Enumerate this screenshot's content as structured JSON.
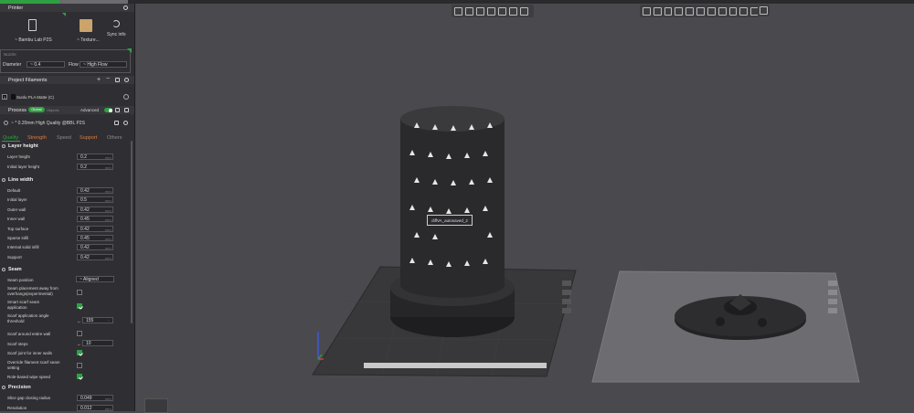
{
  "printer": {
    "section_title": "Printer",
    "printer_name": "Bambu Lab P2S",
    "plate_label": "Texture...",
    "sync_label": "Sync info"
  },
  "nozzle": {
    "label": "Nozzle",
    "diameter_label": "Diameter",
    "diameter_value": "0.4",
    "flow_label": "Flow",
    "flow_value": "High Flow"
  },
  "filaments": {
    "section_title": "Project Filaments",
    "items": [
      {
        "index": "1",
        "name": "Sunlu PLA Matte (C)"
      }
    ]
  },
  "process": {
    "section_title": "Process",
    "toggle_global": "Global",
    "toggle_objects": "Objects",
    "advanced_label": "Advanced",
    "profile_name": "* 0.20mm High Quality @BBL P2S",
    "tabs": [
      "Quality",
      "Strength",
      "Speed",
      "Support",
      "Others"
    ]
  },
  "quality": {
    "layer_height": {
      "title": "Layer height",
      "rows": [
        {
          "label": "Layer height",
          "value": "0.2",
          "unit": "mm"
        },
        {
          "label": "Initial layer height",
          "value": "0.2",
          "unit": "mm"
        }
      ]
    },
    "line_width": {
      "title": "Line width",
      "rows": [
        {
          "label": "Default",
          "value": "0.42",
          "unit": "mm"
        },
        {
          "label": "Initial layer",
          "value": "0.5",
          "unit": "mm"
        },
        {
          "label": "Outer wall",
          "value": "0.42",
          "unit": "mm"
        },
        {
          "label": "Inner wall",
          "value": "0.45",
          "unit": "mm"
        },
        {
          "label": "Top surface",
          "value": "0.42",
          "unit": "mm"
        },
        {
          "label": "Sparse infill",
          "value": "0.45",
          "unit": "mm"
        },
        {
          "label": "Internal solid infill",
          "value": "0.42",
          "unit": "mm"
        },
        {
          "label": "Support",
          "value": "0.42",
          "unit": "mm"
        }
      ]
    },
    "seam": {
      "title": "Seam",
      "seam_position_label": "Seam position",
      "seam_position_value": "Aligned",
      "away_overhang_label_1": "Seam placement away from",
      "away_overhang_label_2": "overhangs(experimental)",
      "smart_scarf_label_1": "Smart scarf seam",
      "smart_scarf_label_2": "application",
      "scarf_angle_label_1": "Scarf application angle",
      "scarf_angle_label_2": "threshold",
      "scarf_angle_value": "155",
      "scarf_angle_unit": "°",
      "scarf_entire_label": "Scarf around entire wall",
      "scarf_steps_label": "Scarf steps",
      "scarf_steps_value": "10",
      "scarf_inner_label": "Scarf joint for inner walls",
      "override_scarf_label_1": "Override filament scarf seam",
      "override_scarf_label_2": "setting",
      "role_wipe_label": "Role-based wipe speed"
    },
    "precision": {
      "title": "Precision",
      "rows": [
        {
          "label": "Slice gap closing radius",
          "value": "0.049",
          "unit": "mm"
        },
        {
          "label": "Resolution",
          "value": "0.012",
          "unit": "mm"
        }
      ]
    }
  },
  "viewport": {
    "object_label": "diffVA_autosaved_2"
  },
  "colors": {
    "accent": "#2ea043",
    "panel": "#2f2f33",
    "viewport": "#4a4a4e",
    "bed_active": "#3a3a3d",
    "bed_inactive": "#6e6e72"
  }
}
